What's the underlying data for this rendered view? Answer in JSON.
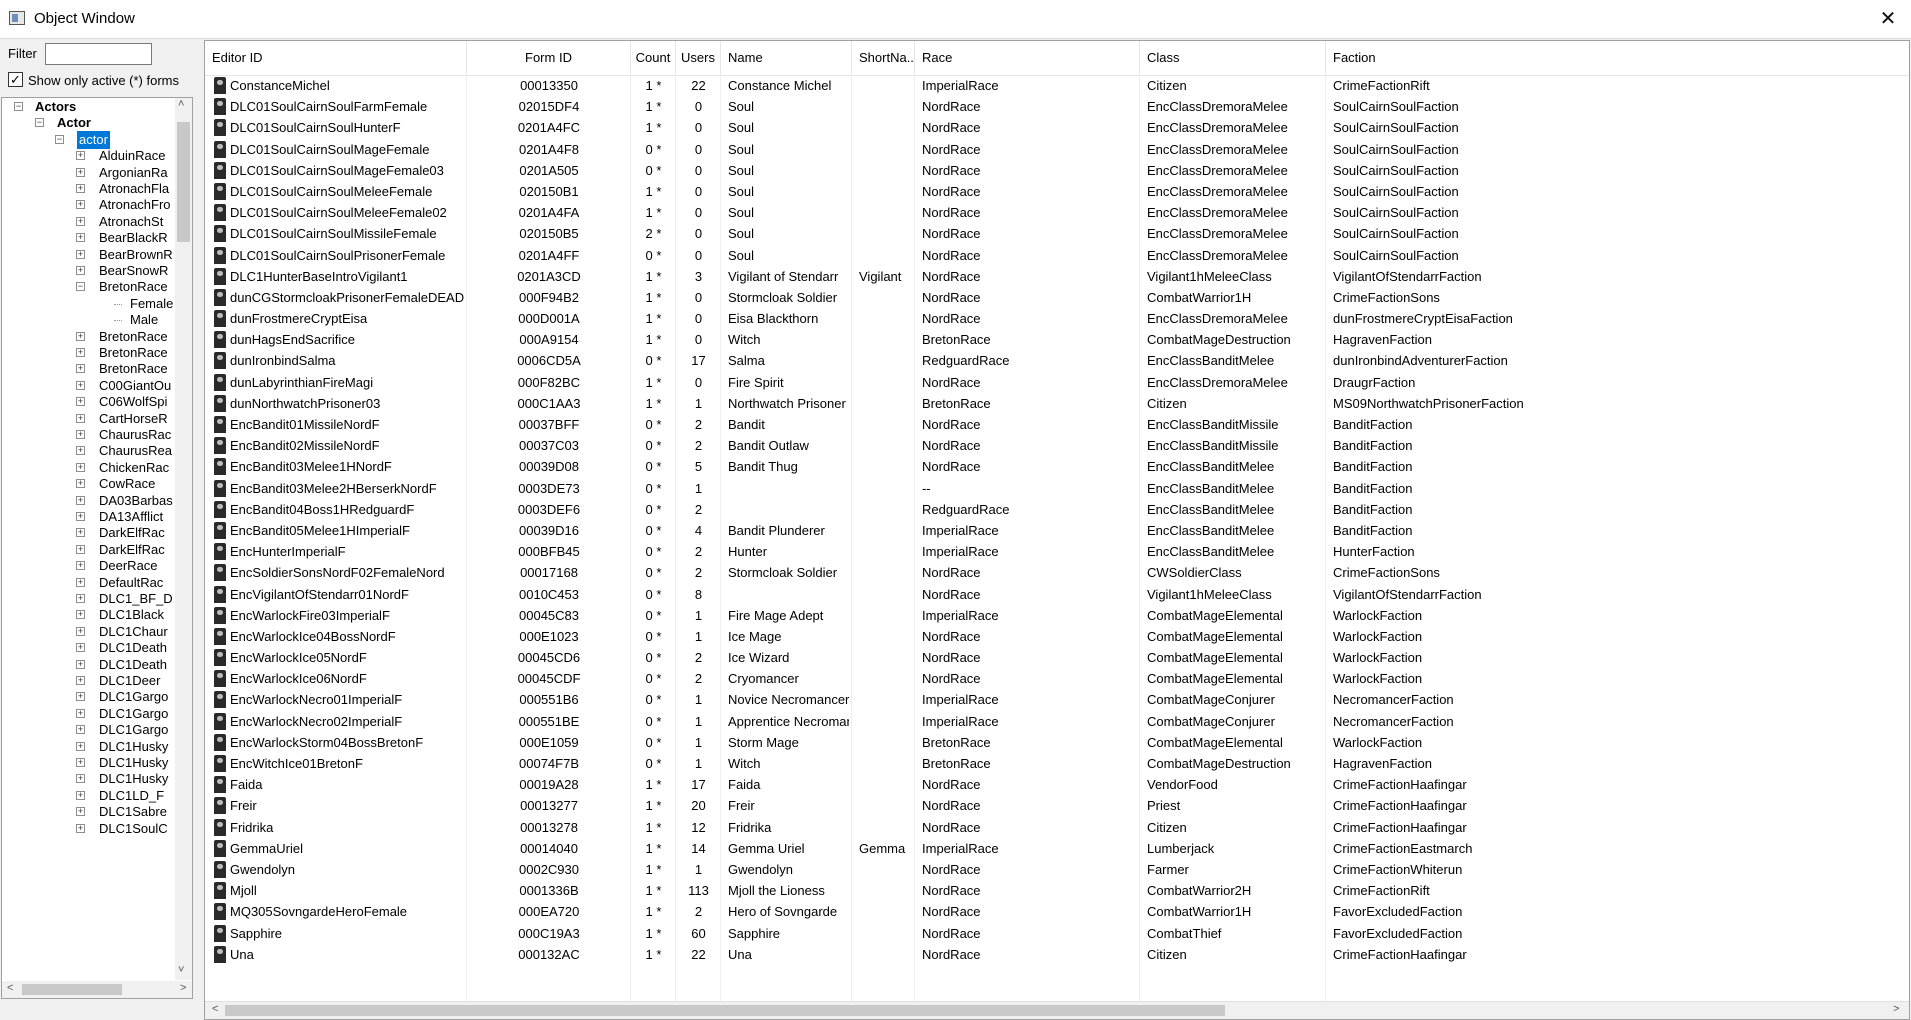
{
  "window": {
    "title": "Object Window",
    "close_glyph": "✕"
  },
  "filter": {
    "label": "Filter",
    "value": ""
  },
  "show_active": {
    "label": "Show only active (*) forms",
    "checked": true,
    "check_glyph": "✓"
  },
  "tree": {
    "nodes": [
      {
        "label": "Actors",
        "level": 0,
        "expander": "−",
        "bold": true
      },
      {
        "label": "Actor",
        "level": 1,
        "expander": "−",
        "bold": true
      },
      {
        "label": "actor",
        "level": 2,
        "expander": "−",
        "selected": true
      },
      {
        "label": "AlduinRace",
        "level": 3,
        "expander": "+"
      },
      {
        "label": "ArgonianRa",
        "level": 3,
        "expander": "+"
      },
      {
        "label": "AtronachFla",
        "level": 3,
        "expander": "+"
      },
      {
        "label": "AtronachFro",
        "level": 3,
        "expander": "+"
      },
      {
        "label": "AtronachSt",
        "level": 3,
        "expander": "+"
      },
      {
        "label": "BearBlackR",
        "level": 3,
        "expander": "+"
      },
      {
        "label": "BearBrownR",
        "level": 3,
        "expander": "+"
      },
      {
        "label": "BearSnowR",
        "level": 3,
        "expander": "+"
      },
      {
        "label": "BretonRace",
        "level": 3,
        "expander": "−"
      },
      {
        "label": "Female",
        "level": 4,
        "expander": ""
      },
      {
        "label": "Male",
        "level": 4,
        "expander": ""
      },
      {
        "label": "BretonRace",
        "level": 3,
        "expander": "+"
      },
      {
        "label": "BretonRace",
        "level": 3,
        "expander": "+"
      },
      {
        "label": "BretonRace",
        "level": 3,
        "expander": "+"
      },
      {
        "label": "C00GiantOu",
        "level": 3,
        "expander": "+"
      },
      {
        "label": "C06WolfSpi",
        "level": 3,
        "expander": "+"
      },
      {
        "label": "CartHorseR",
        "level": 3,
        "expander": "+"
      },
      {
        "label": "ChaurusRac",
        "level": 3,
        "expander": "+"
      },
      {
        "label": "ChaurusRea",
        "level": 3,
        "expander": "+"
      },
      {
        "label": "ChickenRac",
        "level": 3,
        "expander": "+"
      },
      {
        "label": "CowRace",
        "level": 3,
        "expander": "+"
      },
      {
        "label": "DA03Barbas",
        "level": 3,
        "expander": "+"
      },
      {
        "label": "DA13Afflict",
        "level": 3,
        "expander": "+"
      },
      {
        "label": "DarkElfRac",
        "level": 3,
        "expander": "+"
      },
      {
        "label": "DarkElfRac",
        "level": 3,
        "expander": "+"
      },
      {
        "label": "DeerRace",
        "level": 3,
        "expander": "+"
      },
      {
        "label": "DefaultRac",
        "level": 3,
        "expander": "+"
      },
      {
        "label": "DLC1_BF_D",
        "level": 3,
        "expander": "+"
      },
      {
        "label": "DLC1Black",
        "level": 3,
        "expander": "+"
      },
      {
        "label": "DLC1Chaur",
        "level": 3,
        "expander": "+"
      },
      {
        "label": "DLC1Death",
        "level": 3,
        "expander": "+"
      },
      {
        "label": "DLC1Death",
        "level": 3,
        "expander": "+"
      },
      {
        "label": "DLC1Deer",
        "level": 3,
        "expander": "+"
      },
      {
        "label": "DLC1Gargo",
        "level": 3,
        "expander": "+"
      },
      {
        "label": "DLC1Gargo",
        "level": 3,
        "expander": "+"
      },
      {
        "label": "DLC1Gargo",
        "level": 3,
        "expander": "+"
      },
      {
        "label": "DLC1Husky",
        "level": 3,
        "expander": "+"
      },
      {
        "label": "DLC1Husky",
        "level": 3,
        "expander": "+"
      },
      {
        "label": "DLC1Husky",
        "level": 3,
        "expander": "+"
      },
      {
        "label": "DLC1LD_F",
        "level": 3,
        "expander": "+"
      },
      {
        "label": "DLC1Sabre",
        "level": 3,
        "expander": "+"
      },
      {
        "label": "DLC1SoulC",
        "level": 3,
        "expander": "+"
      }
    ],
    "scroll_up": "˄",
    "scroll_down": "˅",
    "scroll_left": "<",
    "scroll_right": ">"
  },
  "table": {
    "columns": [
      {
        "key": "editor_id",
        "label": "Editor ID"
      },
      {
        "key": "form_id",
        "label": "Form ID"
      },
      {
        "key": "count",
        "label": "Count"
      },
      {
        "key": "users",
        "label": "Users"
      },
      {
        "key": "name",
        "label": "Name"
      },
      {
        "key": "short_name",
        "label": "ShortNa..."
      },
      {
        "key": "race",
        "label": "Race"
      },
      {
        "key": "class",
        "label": "Class"
      },
      {
        "key": "faction",
        "label": "Faction"
      }
    ],
    "rows": [
      [
        "ConstanceMichel",
        "00013350",
        "1 *",
        "22",
        "Constance Michel",
        "",
        "ImperialRace",
        "Citizen",
        "CrimeFactionRift"
      ],
      [
        "DLC01SoulCairnSoulFarmFemale",
        "02015DF4",
        "1 *",
        "0",
        "Soul",
        "",
        "NordRace",
        "EncClassDremoraMelee",
        "SoulCairnSoulFaction"
      ],
      [
        "DLC01SoulCairnSoulHunterF",
        "0201A4FC",
        "1 *",
        "0",
        "Soul",
        "",
        "NordRace",
        "EncClassDremoraMelee",
        "SoulCairnSoulFaction"
      ],
      [
        "DLC01SoulCairnSoulMageFemale",
        "0201A4F8",
        "0 *",
        "0",
        "Soul",
        "",
        "NordRace",
        "EncClassDremoraMelee",
        "SoulCairnSoulFaction"
      ],
      [
        "DLC01SoulCairnSoulMageFemale03",
        "0201A505",
        "0 *",
        "0",
        "Soul",
        "",
        "NordRace",
        "EncClassDremoraMelee",
        "SoulCairnSoulFaction"
      ],
      [
        "DLC01SoulCairnSoulMeleeFemale",
        "020150B1",
        "1 *",
        "0",
        "Soul",
        "",
        "NordRace",
        "EncClassDremoraMelee",
        "SoulCairnSoulFaction"
      ],
      [
        "DLC01SoulCairnSoulMeleeFemale02",
        "0201A4FA",
        "1 *",
        "0",
        "Soul",
        "",
        "NordRace",
        "EncClassDremoraMelee",
        "SoulCairnSoulFaction"
      ],
      [
        "DLC01SoulCairnSoulMissileFemale",
        "020150B5",
        "2 *",
        "0",
        "Soul",
        "",
        "NordRace",
        "EncClassDremoraMelee",
        "SoulCairnSoulFaction"
      ],
      [
        "DLC01SoulCairnSoulPrisonerFemale",
        "0201A4FF",
        "0 *",
        "0",
        "Soul",
        "",
        "NordRace",
        "EncClassDremoraMelee",
        "SoulCairnSoulFaction"
      ],
      [
        "DLC1HunterBaseIntroVigilant1",
        "0201A3CD",
        "1 *",
        "3",
        "Vigilant of Stendarr",
        "Vigilant",
        "NordRace",
        "Vigilant1hMeleeClass",
        "VigilantOfStendarrFaction"
      ],
      [
        "dunCGStormcloakPrisonerFemaleDEAD",
        "000F94B2",
        "1 *",
        "0",
        "Stormcloak Soldier",
        "",
        "NordRace",
        "CombatWarrior1H",
        "CrimeFactionSons"
      ],
      [
        "dunFrostmereCryptEisa",
        "000D001A",
        "1 *",
        "0",
        "Eisa Blackthorn",
        "",
        "NordRace",
        "EncClassDremoraMelee",
        "dunFrostmereCryptEisaFaction"
      ],
      [
        "dunHagsEndSacrifice",
        "000A9154",
        "1 *",
        "0",
        "Witch",
        "",
        "BretonRace",
        "CombatMageDestruction",
        "HagravenFaction"
      ],
      [
        "dunIronbindSalma",
        "0006CD5A",
        "0 *",
        "17",
        "Salma",
        "",
        "RedguardRace",
        "EncClassBanditMelee",
        "dunIronbindAdventurerFaction"
      ],
      [
        "dunLabyrinthianFireMagi",
        "000F82BC",
        "1 *",
        "0",
        "Fire Spirit",
        "",
        "NordRace",
        "EncClassDremoraMelee",
        "DraugrFaction"
      ],
      [
        "dunNorthwatchPrisoner03",
        "000C1AA3",
        "1 *",
        "1",
        "Northwatch Prisoner",
        "",
        "BretonRace",
        "Citizen",
        "MS09NorthwatchPrisonerFaction"
      ],
      [
        "EncBandit01MissileNordF",
        "00037BFF",
        "0 *",
        "2",
        "Bandit",
        "",
        "NordRace",
        "EncClassBanditMissile",
        "BanditFaction"
      ],
      [
        "EncBandit02MissileNordF",
        "00037C03",
        "0 *",
        "2",
        "Bandit Outlaw",
        "",
        "NordRace",
        "EncClassBanditMissile",
        "BanditFaction"
      ],
      [
        "EncBandit03Melee1HNordF",
        "00039D08",
        "0 *",
        "5",
        "Bandit Thug",
        "",
        "NordRace",
        "EncClassBanditMelee",
        "BanditFaction"
      ],
      [
        "EncBandit03Melee2HBerserkNordF",
        "0003DE73",
        "0 *",
        "1",
        "",
        "",
        "--",
        "EncClassBanditMelee",
        "BanditFaction"
      ],
      [
        "EncBandit04Boss1HRedguardF",
        "0003DEF6",
        "0 *",
        "2",
        "",
        "",
        "RedguardRace",
        "EncClassBanditMelee",
        "BanditFaction"
      ],
      [
        "EncBandit05Melee1HImperialF",
        "00039D16",
        "0 *",
        "4",
        "Bandit Plunderer",
        "",
        "ImperialRace",
        "EncClassBanditMelee",
        "BanditFaction"
      ],
      [
        "EncHunterImperialF",
        "000BFB45",
        "0 *",
        "2",
        "Hunter",
        "",
        "ImperialRace",
        "EncClassBanditMelee",
        "HunterFaction"
      ],
      [
        "EncSoldierSonsNordF02FemaleNord",
        "00017168",
        "0 *",
        "2",
        "Stormcloak Soldier",
        "",
        "NordRace",
        "CWSoldierClass",
        "CrimeFactionSons"
      ],
      [
        "EncVigilantOfStendarr01NordF",
        "0010C453",
        "0 *",
        "8",
        "",
        "",
        "NordRace",
        "Vigilant1hMeleeClass",
        "VigilantOfStendarrFaction"
      ],
      [
        "EncWarlockFire03ImperialF",
        "00045C83",
        "0 *",
        "1",
        "Fire Mage Adept",
        "",
        "ImperialRace",
        "CombatMageElemental",
        "WarlockFaction"
      ],
      [
        "EncWarlockIce04BossNordF",
        "000E1023",
        "0 *",
        "1",
        "Ice Mage",
        "",
        "NordRace",
        "CombatMageElemental",
        "WarlockFaction"
      ],
      [
        "EncWarlockIce05NordF",
        "00045CD6",
        "0 *",
        "2",
        "Ice Wizard",
        "",
        "NordRace",
        "CombatMageElemental",
        "WarlockFaction"
      ],
      [
        "EncWarlockIce06NordF",
        "00045CDF",
        "0 *",
        "2",
        "Cryomancer",
        "",
        "NordRace",
        "CombatMageElemental",
        "WarlockFaction"
      ],
      [
        "EncWarlockNecro01ImperialF",
        "000551B6",
        "0 *",
        "1",
        "Novice Necromancer",
        "",
        "ImperialRace",
        "CombatMageConjurer",
        "NecromancerFaction"
      ],
      [
        "EncWarlockNecro02ImperialF",
        "000551BE",
        "0 *",
        "1",
        "Apprentice Necroman...",
        "",
        "ImperialRace",
        "CombatMageConjurer",
        "NecromancerFaction"
      ],
      [
        "EncWarlockStorm04BossBretonF",
        "000E1059",
        "0 *",
        "1",
        "Storm Mage",
        "",
        "BretonRace",
        "CombatMageElemental",
        "WarlockFaction"
      ],
      [
        "EncWitchIce01BretonF",
        "00074F7B",
        "0 *",
        "1",
        "Witch",
        "",
        "BretonRace",
        "CombatMageDestruction",
        "HagravenFaction"
      ],
      [
        "Faida",
        "00019A28",
        "1 *",
        "17",
        "Faida",
        "",
        "NordRace",
        "VendorFood",
        "CrimeFactionHaafingar"
      ],
      [
        "Freir",
        "00013277",
        "1 *",
        "20",
        "Freir",
        "",
        "NordRace",
        "Priest",
        "CrimeFactionHaafingar"
      ],
      [
        "Fridrika",
        "00013278",
        "1 *",
        "12",
        "Fridrika",
        "",
        "NordRace",
        "Citizen",
        "CrimeFactionHaafingar"
      ],
      [
        "GemmaUriel",
        "00014040",
        "1 *",
        "14",
        "Gemma Uriel",
        "Gemma",
        "ImperialRace",
        "Lumberjack",
        "CrimeFactionEastmarch"
      ],
      [
        "Gwendolyn",
        "0002C930",
        "1 *",
        "1",
        "Gwendolyn",
        "",
        "NordRace",
        "Farmer",
        "CrimeFactionWhiterun"
      ],
      [
        "Mjoll",
        "0001336B",
        "1 *",
        "113",
        "Mjoll the Lioness",
        "",
        "NordRace",
        "CombatWarrior2H",
        "CrimeFactionRift"
      ],
      [
        "MQ305SovngardeHeroFemale",
        "000EA720",
        "1 *",
        "2",
        "Hero of Sovngarde",
        "",
        "NordRace",
        "CombatWarrior1H",
        "FavorExcludedFaction"
      ],
      [
        "Sapphire",
        "000C19A3",
        "1 *",
        "60",
        "Sapphire",
        "",
        "NordRace",
        "CombatThief",
        "FavorExcludedFaction"
      ],
      [
        "Una",
        "000132AC",
        "1 *",
        "22",
        "Una",
        "",
        "NordRace",
        "Citizen",
        "CrimeFactionHaafingar"
      ]
    ],
    "scroll_left": "<",
    "scroll_right": ">"
  }
}
